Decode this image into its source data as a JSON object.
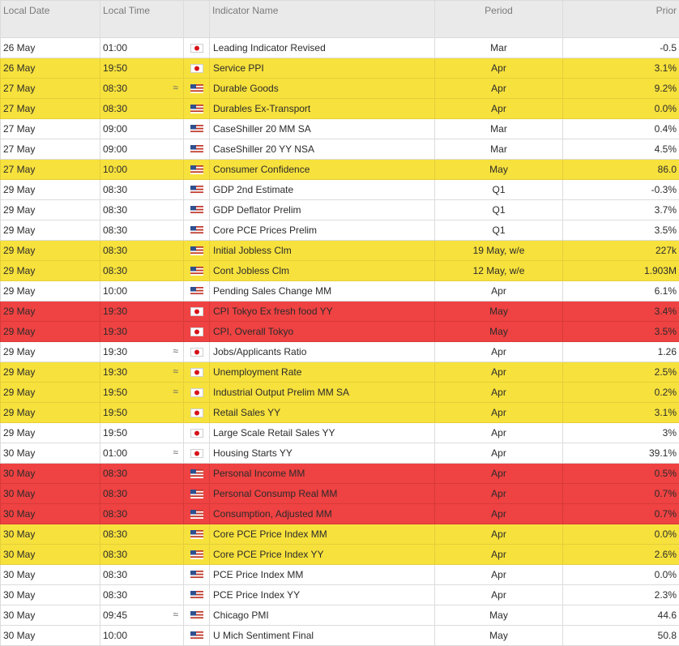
{
  "colors": {
    "header_bg": "#eaeaea",
    "highlight_yellow": "#f7e13c",
    "highlight_red": "#ef4242",
    "white": "#ffffff"
  },
  "headers": {
    "date": "Local Date",
    "time": "Local Time",
    "flag": "",
    "name": "Indicator Name",
    "period": "Period",
    "prior": "Prior"
  },
  "rows": [
    {
      "date": "26 May",
      "time": "01:00",
      "approx": "",
      "flag": "japan-flag-icon",
      "name": "Leading Indicator Revised",
      "period": "Mar",
      "prior": "-0.5",
      "highlight": "white"
    },
    {
      "date": "26 May",
      "time": "19:50",
      "approx": "",
      "flag": "japan-flag-icon",
      "name": "Service PPI",
      "period": "Apr",
      "prior": "3.1%",
      "highlight": "yellow"
    },
    {
      "date": "27 May",
      "time": "08:30",
      "approx": "≈",
      "flag": "us-flag-icon",
      "name": "Durable Goods",
      "period": "Apr",
      "prior": "9.2%",
      "highlight": "yellow"
    },
    {
      "date": "27 May",
      "time": "08:30",
      "approx": "",
      "flag": "us-flag-icon",
      "name": "Durables Ex-Transport",
      "period": "Apr",
      "prior": "0.0%",
      "highlight": "yellow"
    },
    {
      "date": "27 May",
      "time": "09:00",
      "approx": "",
      "flag": "us-flag-icon",
      "name": "CaseShiller 20 MM SA",
      "period": "Mar",
      "prior": "0.4%",
      "highlight": "white"
    },
    {
      "date": "27 May",
      "time": "09:00",
      "approx": "",
      "flag": "us-flag-icon",
      "name": "CaseShiller 20 YY NSA",
      "period": "Mar",
      "prior": "4.5%",
      "highlight": "white"
    },
    {
      "date": "27 May",
      "time": "10:00",
      "approx": "",
      "flag": "us-flag-icon",
      "name": "Consumer Confidence",
      "period": "May",
      "prior": "86.0",
      "highlight": "yellow"
    },
    {
      "date": "29 May",
      "time": "08:30",
      "approx": "",
      "flag": "us-flag-icon",
      "name": "GDP 2nd Estimate",
      "period": "Q1",
      "prior": "-0.3%",
      "highlight": "white"
    },
    {
      "date": "29 May",
      "time": "08:30",
      "approx": "",
      "flag": "us-flag-icon",
      "name": "GDP Deflator Prelim",
      "period": "Q1",
      "prior": "3.7%",
      "highlight": "white"
    },
    {
      "date": "29 May",
      "time": "08:30",
      "approx": "",
      "flag": "us-flag-icon",
      "name": "Core PCE Prices Prelim",
      "period": "Q1",
      "prior": "3.5%",
      "highlight": "white"
    },
    {
      "date": "29 May",
      "time": "08:30",
      "approx": "",
      "flag": "us-flag-icon",
      "name": "Initial Jobless Clm",
      "period": "19 May, w/e",
      "prior": "227k",
      "highlight": "yellow"
    },
    {
      "date": "29 May",
      "time": "08:30",
      "approx": "",
      "flag": "us-flag-icon",
      "name": "Cont Jobless Clm",
      "period": "12 May, w/e",
      "prior": "1.903M",
      "highlight": "yellow"
    },
    {
      "date": "29 May",
      "time": "10:00",
      "approx": "",
      "flag": "us-flag-icon",
      "name": "Pending Sales Change MM",
      "period": "Apr",
      "prior": "6.1%",
      "highlight": "white"
    },
    {
      "date": "29 May",
      "time": "19:30",
      "approx": "",
      "flag": "japan-flag-icon",
      "name": "CPI Tokyo Ex fresh food YY",
      "period": "May",
      "prior": "3.4%",
      "highlight": "red"
    },
    {
      "date": "29 May",
      "time": "19:30",
      "approx": "",
      "flag": "japan-flag-icon",
      "name": "CPI, Overall Tokyo",
      "period": "May",
      "prior": "3.5%",
      "highlight": "red"
    },
    {
      "date": "29 May",
      "time": "19:30",
      "approx": "≈",
      "flag": "japan-flag-icon",
      "name": "Jobs/Applicants Ratio",
      "period": "Apr",
      "prior": "1.26",
      "highlight": "white"
    },
    {
      "date": "29 May",
      "time": "19:30",
      "approx": "≈",
      "flag": "japan-flag-icon",
      "name": "Unemployment Rate",
      "period": "Apr",
      "prior": "2.5%",
      "highlight": "yellow"
    },
    {
      "date": "29 May",
      "time": "19:50",
      "approx": "≈",
      "flag": "japan-flag-icon",
      "name": "Industrial Output Prelim MM SA",
      "period": "Apr",
      "prior": "0.2%",
      "highlight": "yellow"
    },
    {
      "date": "29 May",
      "time": "19:50",
      "approx": "",
      "flag": "japan-flag-icon",
      "name": "Retail Sales YY",
      "period": "Apr",
      "prior": "3.1%",
      "highlight": "yellow"
    },
    {
      "date": "29 May",
      "time": "19:50",
      "approx": "",
      "flag": "japan-flag-icon",
      "name": "Large Scale Retail Sales YY",
      "period": "Apr",
      "prior": "3%",
      "highlight": "white"
    },
    {
      "date": "30 May",
      "time": "01:00",
      "approx": "≈",
      "flag": "japan-flag-icon",
      "name": "Housing Starts YY",
      "period": "Apr",
      "prior": "39.1%",
      "highlight": "white"
    },
    {
      "date": "30 May",
      "time": "08:30",
      "approx": "",
      "flag": "us-flag-icon",
      "name": "Personal Income MM",
      "period": "Apr",
      "prior": "0.5%",
      "highlight": "red"
    },
    {
      "date": "30 May",
      "time": "08:30",
      "approx": "",
      "flag": "us-flag-icon",
      "name": "Personal Consump Real MM",
      "period": "Apr",
      "prior": "0.7%",
      "highlight": "red"
    },
    {
      "date": "30 May",
      "time": "08:30",
      "approx": "",
      "flag": "us-flag-icon",
      "name": "Consumption, Adjusted MM",
      "period": "Apr",
      "prior": "0.7%",
      "highlight": "red"
    },
    {
      "date": "30 May",
      "time": "08:30",
      "approx": "",
      "flag": "us-flag-icon",
      "name": "Core PCE Price Index MM",
      "period": "Apr",
      "prior": "0.0%",
      "highlight": "yellow"
    },
    {
      "date": "30 May",
      "time": "08:30",
      "approx": "",
      "flag": "us-flag-icon",
      "name": "Core PCE Price Index YY",
      "period": "Apr",
      "prior": "2.6%",
      "highlight": "yellow"
    },
    {
      "date": "30 May",
      "time": "08:30",
      "approx": "",
      "flag": "us-flag-icon",
      "name": "PCE Price Index MM",
      "period": "Apr",
      "prior": "0.0%",
      "highlight": "white"
    },
    {
      "date": "30 May",
      "time": "08:30",
      "approx": "",
      "flag": "us-flag-icon",
      "name": "PCE Price Index YY",
      "period": "Apr",
      "prior": "2.3%",
      "highlight": "white"
    },
    {
      "date": "30 May",
      "time": "09:45",
      "approx": "≈",
      "flag": "us-flag-icon",
      "name": "Chicago PMI",
      "period": "May",
      "prior": "44.6",
      "highlight": "white"
    },
    {
      "date": "30 May",
      "time": "10:00",
      "approx": "",
      "flag": "us-flag-icon",
      "name": "U Mich Sentiment Final",
      "period": "May",
      "prior": "50.8",
      "highlight": "white"
    }
  ]
}
